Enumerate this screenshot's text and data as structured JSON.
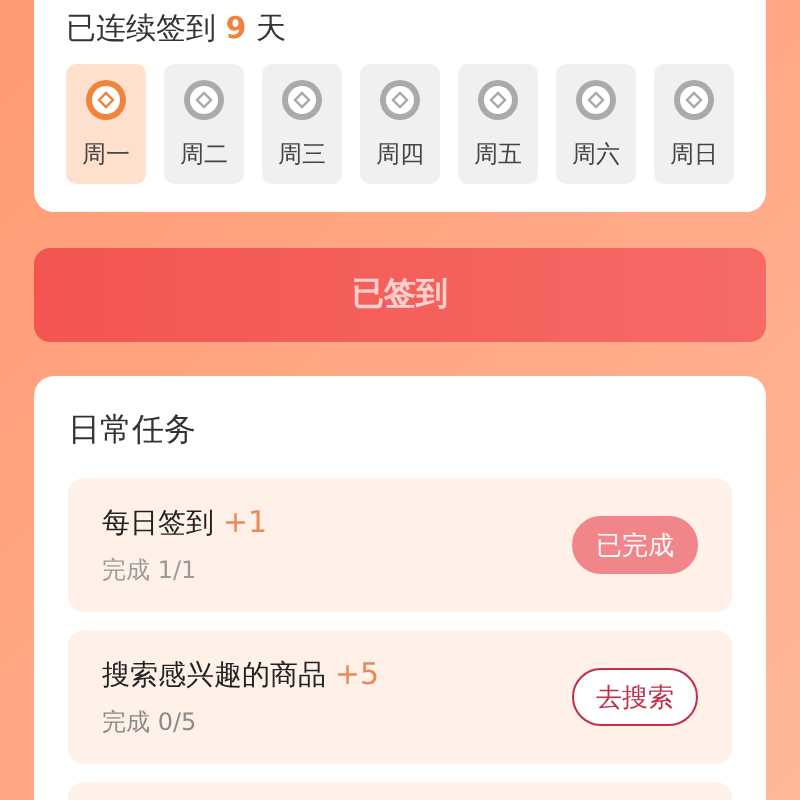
{
  "streak": {
    "prefix": "已连续签到",
    "count": "9",
    "suffix": "天"
  },
  "days": [
    {
      "label": "周一",
      "signed": true
    },
    {
      "label": "周二",
      "signed": false
    },
    {
      "label": "周三",
      "signed": false
    },
    {
      "label": "周四",
      "signed": false
    },
    {
      "label": "周五",
      "signed": false
    },
    {
      "label": "周六",
      "signed": false
    },
    {
      "label": "周日",
      "signed": false
    }
  ],
  "sign_button": {
    "label": "已签到",
    "disabled": true
  },
  "tasks_title": "日常任务",
  "tasks": [
    {
      "title": "每日签到",
      "points": "+1",
      "progress": "完成 1/1",
      "completed": true,
      "action": {
        "label": "已完成",
        "kind": "done"
      }
    },
    {
      "title": "搜索感兴趣的商品",
      "points": "+5",
      "progress": "完成 0/5",
      "completed": false,
      "action": {
        "label": "去搜索",
        "kind": "go"
      }
    }
  ]
}
